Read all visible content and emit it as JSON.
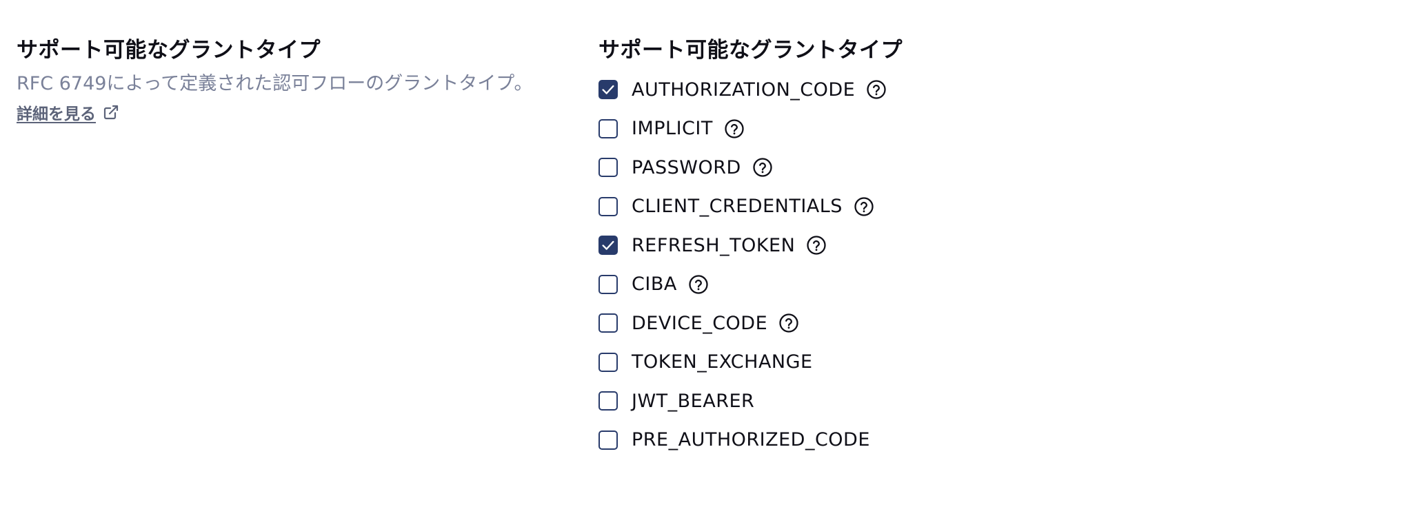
{
  "left": {
    "title": "サポート可能なグラントタイプ",
    "description": "RFC 6749によって定義された認可フローのグラントタイプ。",
    "learn_more": "詳細を見る",
    "learn_more_icon": "external-link-icon"
  },
  "right": {
    "title": "サポート可能なグラントタイプ",
    "grant_types": [
      {
        "label": "AUTHORIZATION_CODE",
        "checked": true,
        "help": true
      },
      {
        "label": "IMPLICIT",
        "checked": false,
        "help": true
      },
      {
        "label": "PASSWORD",
        "checked": false,
        "help": true
      },
      {
        "label": "CLIENT_CREDENTIALS",
        "checked": false,
        "help": true
      },
      {
        "label": "REFRESH_TOKEN",
        "checked": true,
        "help": true
      },
      {
        "label": "CIBA",
        "checked": false,
        "help": true
      },
      {
        "label": "DEVICE_CODE",
        "checked": false,
        "help": true
      },
      {
        "label": "TOKEN_EXCHANGE",
        "checked": false,
        "help": false
      },
      {
        "label": "JWT_BEARER",
        "checked": false,
        "help": false
      },
      {
        "label": "PRE_AUTHORIZED_CODE",
        "checked": false,
        "help": false
      }
    ]
  },
  "colors": {
    "accent": "#283b6b",
    "muted_text": "#7a8199",
    "link_text": "#5c6379"
  }
}
